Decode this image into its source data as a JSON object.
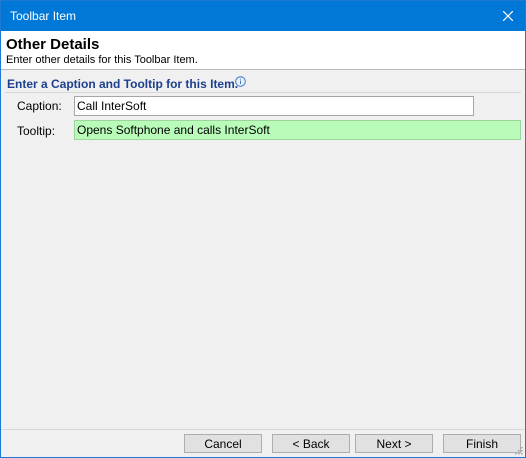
{
  "window": {
    "title": "Toolbar Item",
    "accent_color": "#0078d7"
  },
  "header": {
    "title": "Other Details",
    "subtitle": "Enter other details for this Toolbar Item."
  },
  "section": {
    "title": "Enter a Caption and Tooltip for this Item.",
    "info_icon": "info-icon"
  },
  "fields": {
    "caption": {
      "label": "Caption:",
      "value": "Call InterSoft"
    },
    "tooltip": {
      "label": "Tooltip:",
      "value": "Opens Softphone and calls InterSoft",
      "highlight_color": "#b9fbb9"
    }
  },
  "buttons": {
    "cancel": "Cancel",
    "back": "< Back",
    "next": "Next >",
    "finish": "Finish"
  }
}
